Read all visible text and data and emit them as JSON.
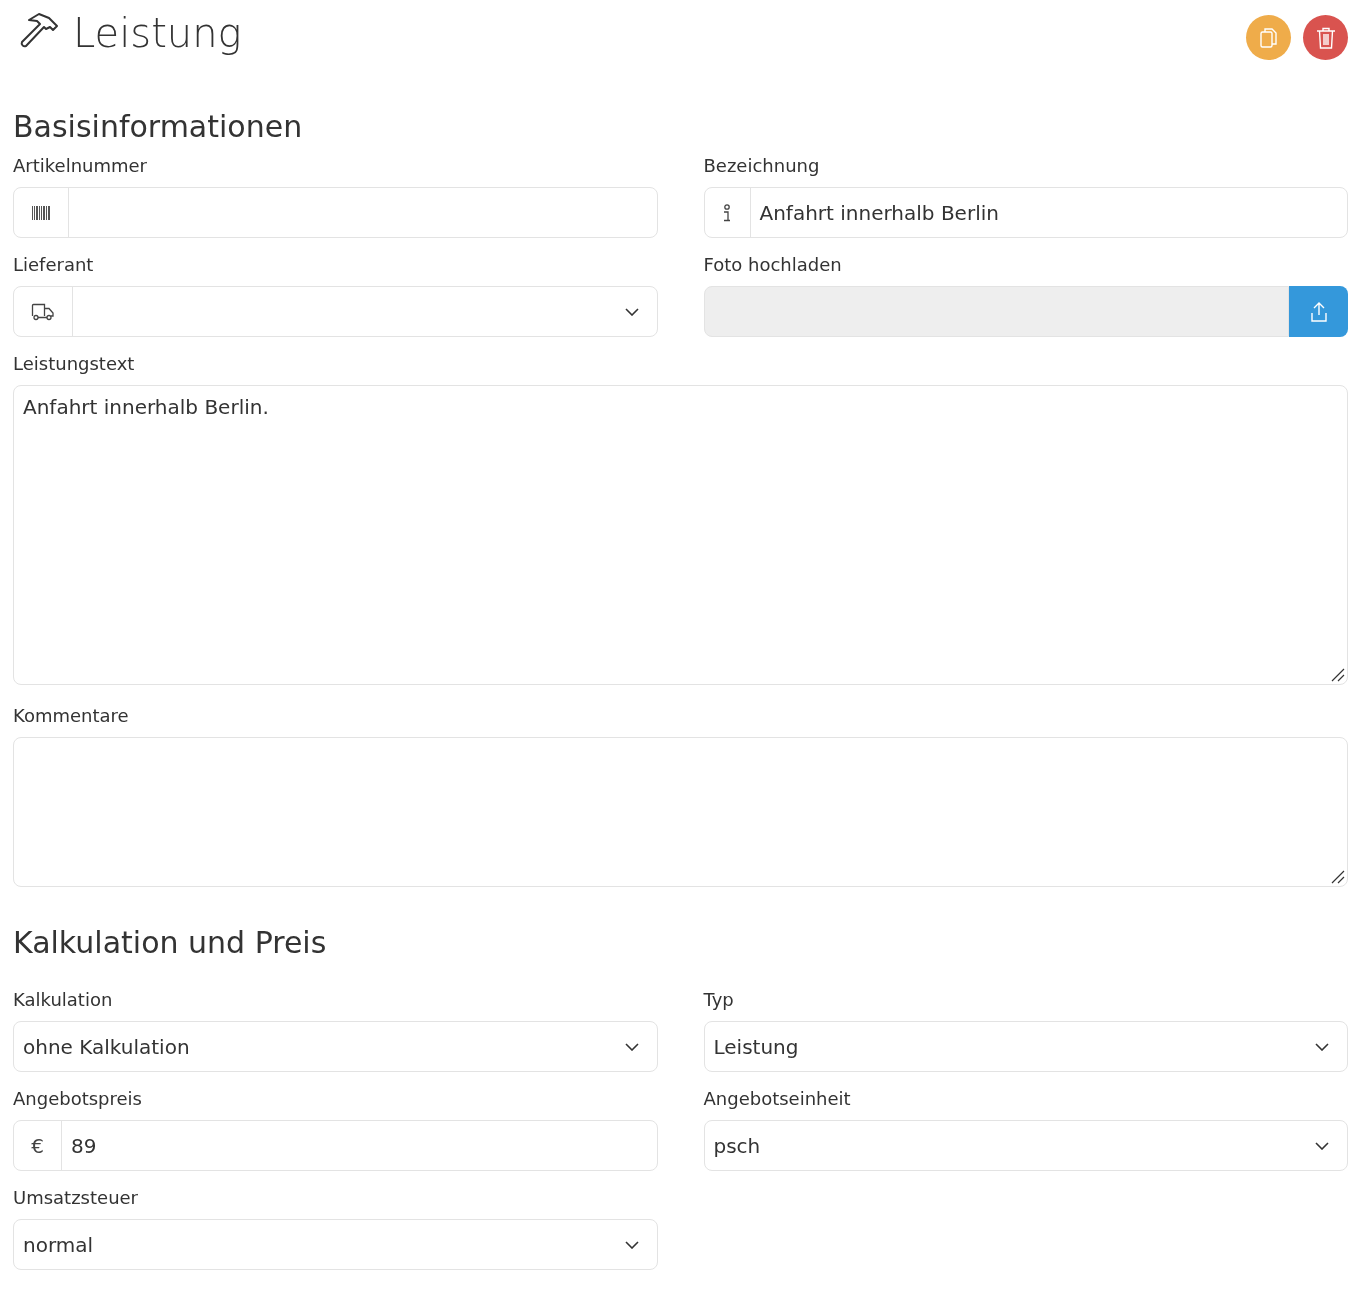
{
  "page": {
    "title": "Leistung"
  },
  "header_buttons": [
    {
      "kind": "copy"
    },
    {
      "kind": "delete"
    }
  ],
  "sections": [
    {
      "title": "Basisinformationen",
      "fields": [
        {
          "kind": "text",
          "label": "Artikelnummer"
        },
        {
          "kind": "text",
          "label": "Bezeichnung",
          "value": "Anfahrt innerhalb Berlin"
        },
        {
          "kind": "select",
          "label": "Lieferant"
        },
        {
          "kind": "file",
          "label": "Foto hochladen"
        },
        {
          "kind": "textarea",
          "label": "Leistungstext",
          "value": "Anfahrt innerhalb Berlin."
        },
        {
          "kind": "textarea",
          "label": "Kommentare"
        }
      ]
    },
    {
      "title": "Kalkulation und Preis",
      "fields": [
        {
          "kind": "select",
          "label": "Kalkulation",
          "value": "ohne Kalkulation"
        },
        {
          "kind": "select",
          "label": "Typ",
          "value": "Leistung"
        },
        {
          "kind": "text",
          "label": "Angebotspreis",
          "prefix": "€",
          "value": "89"
        },
        {
          "kind": "select",
          "label": "Angebotseinheit",
          "value": "psch"
        },
        {
          "kind": "select",
          "label": "Umsatzsteuer",
          "value": "normal"
        }
      ]
    }
  ]
}
